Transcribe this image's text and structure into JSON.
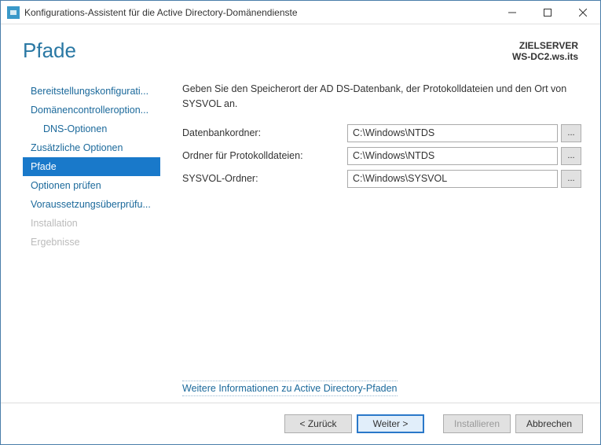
{
  "window": {
    "title": "Konfigurations-Assistent für die Active Directory-Domänendienste"
  },
  "page": {
    "heading": "Pfade",
    "target_label": "ZIELSERVER",
    "target_value": "WS-DC2.ws.its"
  },
  "nav": {
    "items": [
      {
        "label": "Bereitstellungskonfigurati...",
        "active": false,
        "disabled": false,
        "sub": false
      },
      {
        "label": "Domänencontrolleroption...",
        "active": false,
        "disabled": false,
        "sub": false
      },
      {
        "label": "DNS-Optionen",
        "active": false,
        "disabled": false,
        "sub": true
      },
      {
        "label": "Zusätzliche Optionen",
        "active": false,
        "disabled": false,
        "sub": false
      },
      {
        "label": "Pfade",
        "active": true,
        "disabled": false,
        "sub": false
      },
      {
        "label": "Optionen prüfen",
        "active": false,
        "disabled": false,
        "sub": false
      },
      {
        "label": "Voraussetzungsüberprüfu...",
        "active": false,
        "disabled": false,
        "sub": false
      },
      {
        "label": "Installation",
        "active": false,
        "disabled": true,
        "sub": false
      },
      {
        "label": "Ergebnisse",
        "active": false,
        "disabled": true,
        "sub": false
      }
    ]
  },
  "content": {
    "description": "Geben Sie den Speicherort der AD DS-Datenbank, der Protokolldateien und den Ort von SYSVOL an.",
    "fields": {
      "db_label": "Datenbankordner:",
      "db_value": "C:\\Windows\\NTDS",
      "log_label": "Ordner für Protokolldateien:",
      "log_value": "C:\\Windows\\NTDS",
      "sysvol_label": "SYSVOL-Ordner:",
      "sysvol_value": "C:\\Windows\\SYSVOL",
      "browse_label": "..."
    },
    "more_link": "Weitere Informationen zu Active Directory-Pfaden"
  },
  "footer": {
    "back": "< Zurück",
    "next": "Weiter >",
    "install": "Installieren",
    "cancel": "Abbrechen"
  }
}
